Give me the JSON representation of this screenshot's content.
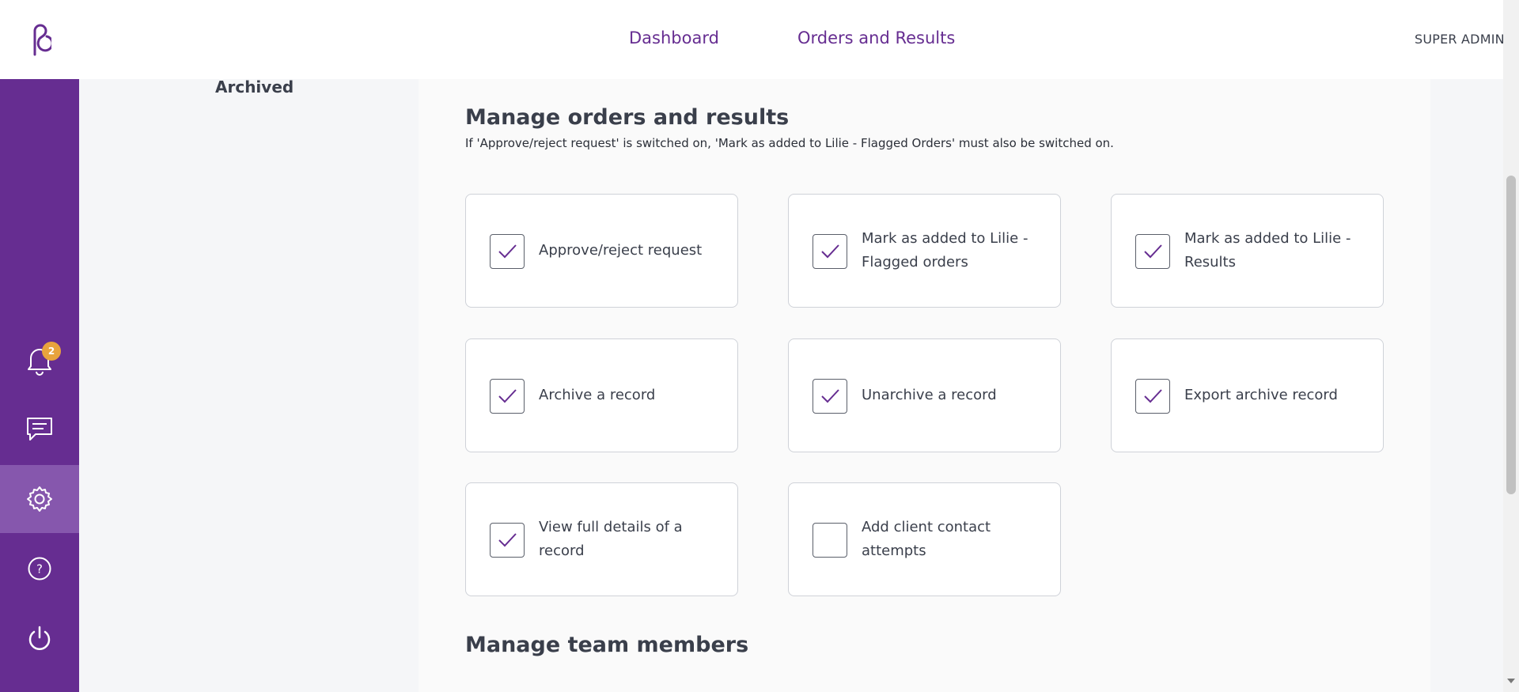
{
  "nav": {
    "dashboard": "Dashboard",
    "orders_results": "Orders and Results",
    "mode": "SUPER ADMIN MODE"
  },
  "sidebar": {
    "notifications_count": "2",
    "icons": [
      "logo-icon",
      "bell-icon",
      "chat-icon",
      "gear-icon",
      "help-icon",
      "power-icon"
    ]
  },
  "left_menu": {
    "archived": "Archived"
  },
  "orders_section": {
    "title": "Manage orders and results",
    "note": "If 'Approve/reject request' is switched on, 'Mark as added to Lilie - Flagged Orders' must also be switched on.",
    "permissions": [
      {
        "label": "Approve/reject request",
        "checked": true
      },
      {
        "label": "Mark as added to Lilie - Flagged orders",
        "checked": true
      },
      {
        "label": "Mark as added to Lilie - Results",
        "checked": true
      },
      {
        "label": "Archive a record",
        "checked": true
      },
      {
        "label": "Unarchive a record",
        "checked": true
      },
      {
        "label": "Export archive record",
        "checked": true
      },
      {
        "label": "View full details of a record",
        "checked": true
      },
      {
        "label": "Add client contact attempts",
        "checked": false
      }
    ]
  },
  "team_section": {
    "title": "Manage team members"
  },
  "colors": {
    "brand": "#662d91",
    "badge": "#e8a33d"
  }
}
